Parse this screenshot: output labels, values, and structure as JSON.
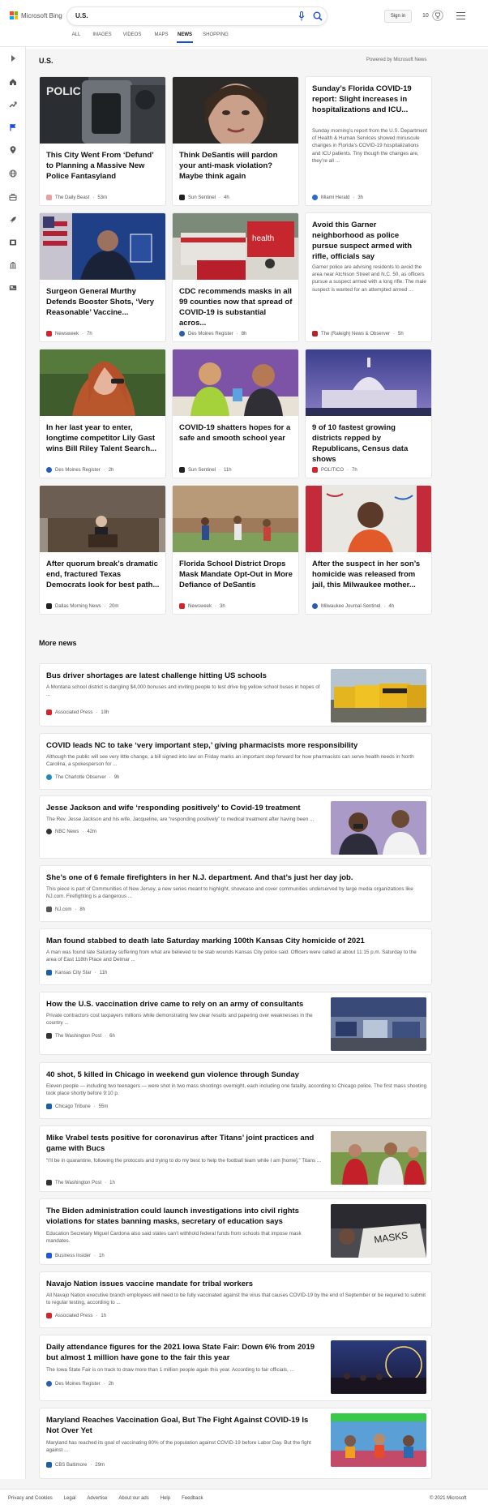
{
  "header": {
    "logo_text": "Microsoft Bing",
    "search_value": "U.S.",
    "signin_label": "Sign in",
    "rewards_count": "10",
    "tabs": [
      {
        "label": "ALL"
      },
      {
        "label": "IMAGES"
      },
      {
        "label": "VIDEOS"
      },
      {
        "label": "MAPS"
      },
      {
        "label": "NEWS"
      },
      {
        "label": "SHOPPING"
      }
    ],
    "active_tab": "NEWS",
    "accent_color": "#174ae4"
  },
  "rail": {
    "icons": [
      "chevron-right-icon",
      "home-icon",
      "trending-icon",
      "flag-icon",
      "location-pin-icon",
      "globe-icon",
      "briefcase-icon",
      "rocket-icon",
      "film-icon",
      "bank-icon",
      "newspaper-icon"
    ]
  },
  "top": {
    "section_title": "U.S.",
    "powered_by": "Powered by Microsoft News",
    "cards": [
      {
        "title": "This City Went From ‘Defund’ to Planning a Massive New Police Fantasyland",
        "source": "The Daily Beast",
        "time": "53m",
        "src_color": "#e8a0a0"
      },
      {
        "title": "Think DeSantis will pardon your anti-mask violation? Maybe think again",
        "source": "Sun Sentinel",
        "time": "4h",
        "src_color": "#222222"
      },
      {
        "title": "Sunday’s Florida COVID-19 report: Slight increases in hospitalizations and ICU...",
        "desc": "Sunday morning’s report from the U.S. Department of Health & Human Services showed minuscule changes in Florida’s COVID-19 hospitalizations and ICU patients. Tiny though the changes are, they’re all ...",
        "source": "Miami Herald",
        "time": "3h",
        "src_color": "#2b6cc4"
      },
      {
        "title": "Surgeon General Murthy Defends Booster Shots, ‘Very Reasonable’ Vaccine...",
        "source": "Newsweek",
        "time": "7h",
        "src_color": "#d2242a"
      },
      {
        "title": "CDC recommends masks in all 99 counties now that spread of COVID-19 is substantial acros...",
        "source": "Des Moines Register",
        "time": "8h",
        "src_color": "#2a5db0"
      },
      {
        "title": "Avoid this Garner neighborhood as police pursue suspect armed with rifle, officials say",
        "desc": "Garner police are advising residents to avoid the area near Atchison Street and N.C. 50, as officers pursue a suspect armed with a long rifle. The male suspect is wanted for an attempted armed ...",
        "source": "The (Raleigh) News & Observer",
        "time": "5h",
        "src_color": "#b3262c"
      },
      {
        "title": "In her last year to enter, longtime competitor Lily Gast wins Bill Riley Talent Search...",
        "source": "Des Moines Register",
        "time": "2h",
        "src_color": "#2a5db0"
      },
      {
        "title": "COVID-19 shatters hopes for a safe and smooth school year",
        "source": "Sun Sentinel",
        "time": "11h",
        "src_color": "#222222"
      },
      {
        "title": "9 of 10 fastest growing districts repped by Republicans, Census data shows",
        "source": "POLITICO",
        "time": "7h",
        "src_color": "#d2242a"
      },
      {
        "title": "After quorum break’s dramatic end, fractured Texas Democrats look for best path...",
        "source": "Dallas Morning News",
        "time": "20m",
        "src_color": "#222222"
      },
      {
        "title": "Florida School District Drops Mask Mandate Opt-Out in More Defiance of DeSantis",
        "source": "Newsweek",
        "time": "3h",
        "src_color": "#d2242a"
      },
      {
        "title": "After the suspect in her son’s homicide was released from jail, this Milwaukee mother...",
        "source": "Milwaukee Journal-Sentinel",
        "time": "4h",
        "src_color": "#2a5db0"
      }
    ]
  },
  "more": {
    "section_title": "More news",
    "items": [
      {
        "title": "Bus driver shortages are latest challenge hitting US schools",
        "desc": "A Montana school district is dangling $4,000 bonuses and inviting people to test drive big yellow school buses in hopes of ...",
        "source": "Associated Press",
        "time": "10h",
        "src_color": "#d2242a"
      },
      {
        "title": "COVID leads NC to take ‘very important step,’ giving pharmacists more responsibility",
        "desc": "Although the public will see very little change, a bill signed into law on Friday marks an important step forward for how pharmacists can serve health needs in North Carolina, a spokesperson for ...",
        "source": "The Charlotte Observer",
        "time": "9h",
        "src_color": "#1f8ac0"
      },
      {
        "title": "Jesse Jackson and wife ‘responding positively’ to Covid-19 treatment",
        "desc": "The Rev. Jesse Jackson and his wife, Jacqueline, are “responding positively” to medical treatment after having been ...",
        "source": "NBC News",
        "time": "42m",
        "src_color": "#333333"
      },
      {
        "title": "She’s one of 6 female firefighters in her N.J. department. And that’s just her day job.",
        "desc": "This piece is part of Communities of New Jersey, a new series meant to highlight, showcase and cover communities underserved by large media organizations like NJ.com. Firefighting is a dangerous ...",
        "source": "NJ.com",
        "time": "8h",
        "src_color": "#555555"
      },
      {
        "title": "Man found stabbed to death late Saturday marking 100th Kansas City homicide of 2021",
        "desc": "A man was found late Saturday suffering from what are believed to be stab wounds Kansas City police said. Officers were called at about 11:15 p.m. Saturday to the area of East 118th Place and Delmar ...",
        "source": "Kansas City Star",
        "time": "11h",
        "src_color": "#1b5fa8"
      },
      {
        "title": "How the U.S. vaccination drive came to rely on an army of consultants",
        "desc": "Private contractors cost taxpayers millions while demonstrating few clear results and papering over weaknesses in the country ...",
        "source": "The Washington Post",
        "time": "6h",
        "src_color": "#333333"
      },
      {
        "title": "40 shot, 5 killed in Chicago in weekend gun violence through Sunday",
        "desc": "Eleven people — including two teenagers — were shot in two mass shootings overnight, each including one fatality, according to Chicago police. The first mass shooting took place shortly before 9:10 p.",
        "source": "Chicago Tribune",
        "time": "55m",
        "src_color": "#1b5fa8"
      },
      {
        "title": "Mike Vrabel tests positive for coronavirus after Titans’ joint practices and game with Bucs",
        "desc": "“I’ll be in quarantine, following the protocols and trying to do my best to help the football team while I am [home],” Titans ...",
        "source": "The Washington Post",
        "time": "1h",
        "src_color": "#333333"
      },
      {
        "title": "The Biden administration could launch investigations into civil rights violations for states banning masks, secretary of education says",
        "desc": "Education Secretary Miguel Cardona also said states can’t withhold federal funds from schools that impose mask mandates.",
        "source": "Business Insider",
        "time": "1h",
        "src_color": "#1d5ad6"
      },
      {
        "title": "Navajo Nation issues vaccine mandate for tribal workers",
        "desc": "All Navajo Nation executive branch employees will need to be fully vaccinated against the virus that causes COVID-19 by the end of September or be required to submit to regular testing, according to ...",
        "source": "Associated Press",
        "time": "1h",
        "src_color": "#d2242a"
      },
      {
        "title": "Daily attendance figures for the 2021 Iowa State Fair: Down 6% from 2019 but almost 1 million have gone to the fair this year",
        "desc": "The Iowa State Fair is on track to draw more than 1 million people again this year. According to fair officials, ...",
        "source": "Des Moines Register",
        "time": "2h",
        "src_color": "#2a5db0"
      },
      {
        "title": "Maryland Reaches Vaccination Goal, But The Fight Against COVID-19 Is Not Over Yet",
        "desc": "Maryland has reached its goal of vaccinating 80% of the population against COVID-19 before Labor Day. But the fight against ...",
        "source": "CBS Baltimore",
        "time": "29m",
        "src_color": "#1b5fa8"
      }
    ]
  },
  "footer": {
    "links": [
      "Privacy and Cookies",
      "Legal",
      "Advertise",
      "About our ads",
      "Help",
      "Feedback"
    ],
    "copyright": "© 2021 Microsoft"
  }
}
